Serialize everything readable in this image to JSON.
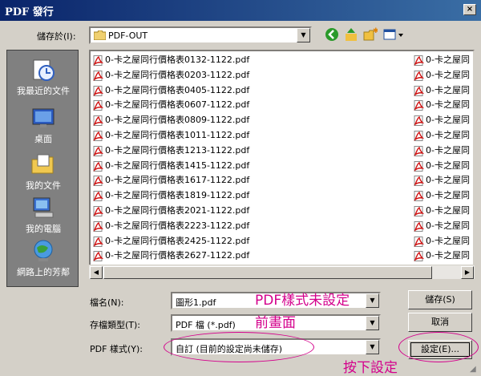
{
  "window": {
    "title": "PDF 發行",
    "close_label": "×"
  },
  "save_in": {
    "label": "儲存於(I):",
    "value": "PDF-OUT"
  },
  "places": [
    {
      "label": "我最近的文件",
      "icon": "recent-docs-icon"
    },
    {
      "label": "桌面",
      "icon": "desktop-icon"
    },
    {
      "label": "我的文件",
      "icon": "my-documents-icon"
    },
    {
      "label": "我的電腦",
      "icon": "my-computer-icon"
    },
    {
      "label": "網路上的芳鄰",
      "icon": "network-icon"
    }
  ],
  "files_left": [
    "0-卡之屋同行價格表0132-1122.pdf",
    "0-卡之屋同行價格表0203-1122.pdf",
    "0-卡之屋同行價格表0405-1122.pdf",
    "0-卡之屋同行價格表0607-1122.pdf",
    "0-卡之屋同行價格表0809-1122.pdf",
    "0-卡之屋同行價格表1011-1122.pdf",
    "0-卡之屋同行價格表1213-1122.pdf",
    "0-卡之屋同行價格表1415-1122.pdf",
    "0-卡之屋同行價格表1617-1122.pdf",
    "0-卡之屋同行價格表1819-1122.pdf",
    "0-卡之屋同行價格表2021-1122.pdf",
    "0-卡之屋同行價格表2223-1122.pdf",
    "0-卡之屋同行價格表2425-1122.pdf",
    "0-卡之屋同行價格表2627-1122.pdf"
  ],
  "files_right": [
    "0-卡之屋同",
    "0-卡之屋同",
    "0-卡之屋同",
    "0-卡之屋同",
    "0-卡之屋同",
    "0-卡之屋同",
    "0-卡之屋同",
    "0-卡之屋同",
    "0-卡之屋同",
    "0-卡之屋同",
    "0-卡之屋同",
    "0-卡之屋同",
    "0-卡之屋同",
    "0-卡之屋同"
  ],
  "filename": {
    "label": "檔名(N):",
    "value": "圖形1.pdf"
  },
  "filetype": {
    "label": "存檔類型(T):",
    "value": "PDF 檔 (*.pdf)"
  },
  "pdf_style": {
    "label": "PDF 樣式(Y):",
    "value": "自訂 (目前的設定尚未儲存)"
  },
  "buttons": {
    "save": "儲存(S)",
    "cancel": "取消",
    "settings": "設定(E)..."
  },
  "annotations": {
    "style_not_set": "PDF樣式未設定",
    "before": "前畫面",
    "press_settings": "按下設定"
  },
  "colors": {
    "annotation": "#d4008c",
    "titlebar": "#0a246a"
  }
}
